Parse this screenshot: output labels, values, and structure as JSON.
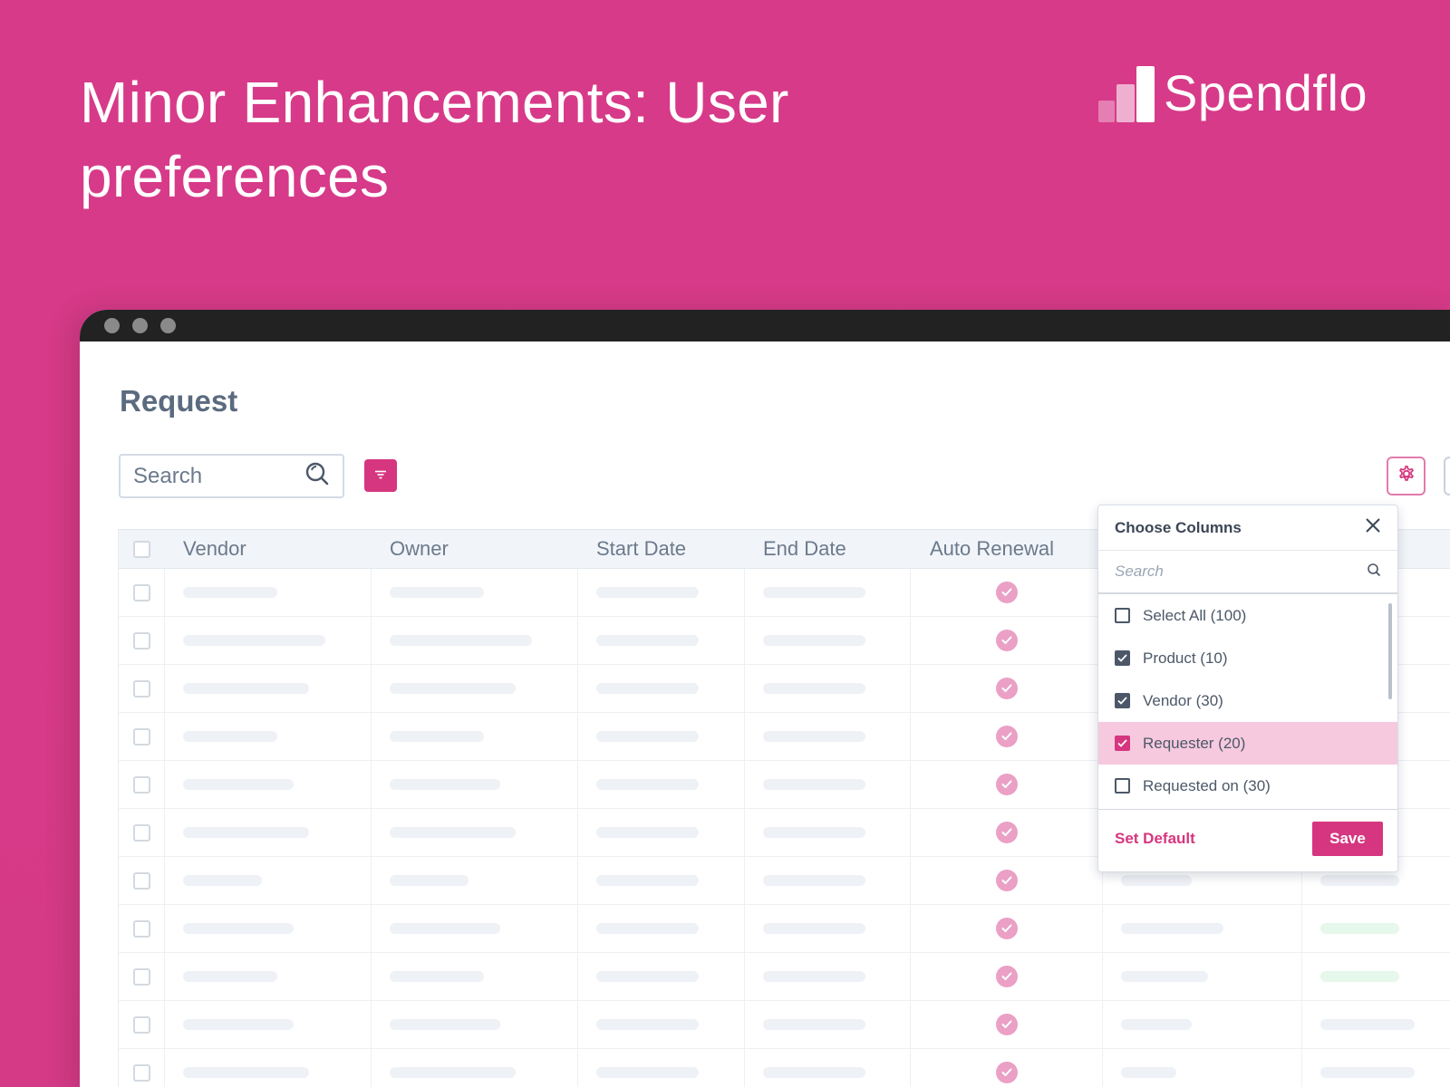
{
  "hero": {
    "title": "Minor Enhancements: User preferences"
  },
  "brand": {
    "name": "Spendflo"
  },
  "page": {
    "title": "Request"
  },
  "search": {
    "placeholder": "Search"
  },
  "table": {
    "columns": [
      "Vendor",
      "Owner",
      "Start Date",
      "End Date",
      "Auto Renewal"
    ]
  },
  "column_picker": {
    "title": "Choose Columns",
    "search_placeholder": "Search",
    "options": [
      {
        "label": "Select All (100)",
        "checked": false
      },
      {
        "label": "Product (10)",
        "checked": true
      },
      {
        "label": "Vendor (30)",
        "checked": true
      },
      {
        "label": "Requester (20)",
        "checked": true,
        "highlighted": true
      },
      {
        "label": "Requested on (30)",
        "checked": false
      }
    ],
    "set_default_label": "Set Default",
    "save_label": "Save"
  },
  "colors": {
    "brand_pink": "#d6367f",
    "background": "#d73a89",
    "check_pink": "#eba0c6"
  },
  "icons": [
    "search-icon",
    "filter-icon",
    "gear-icon",
    "close-icon",
    "check-icon"
  ]
}
